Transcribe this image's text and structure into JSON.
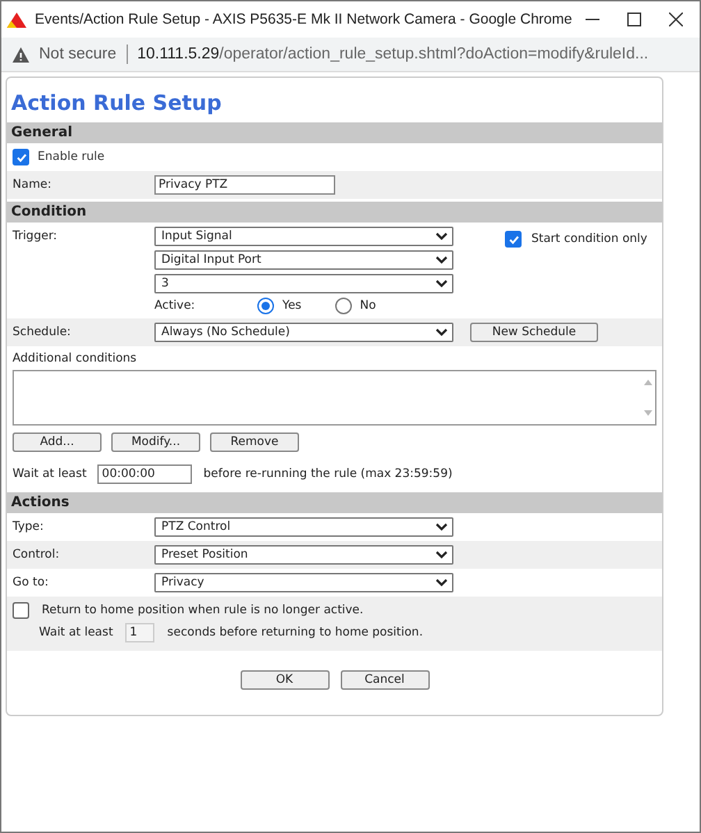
{
  "window": {
    "title": "Events/Action Rule Setup - AXIS P5635-E Mk II Network Camera - Google Chrome"
  },
  "address_bar": {
    "security": "Not secure",
    "url_host": "10.111.5.29",
    "url_path": "/operator/action_rule_setup.shtml?doAction=modify&ruleId..."
  },
  "page_title": "Action Rule Setup",
  "general": {
    "heading": "General",
    "enable_rule": {
      "label": "Enable rule",
      "checked": true
    },
    "name": {
      "label": "Name:",
      "value": "Privacy PTZ"
    }
  },
  "condition": {
    "heading": "Condition",
    "trigger": {
      "label": "Trigger:",
      "selects": [
        "Input Signal",
        "Digital Input Port",
        "3"
      ]
    },
    "start_condition_only": {
      "label": "Start condition only",
      "checked": true
    },
    "active": {
      "label": "Active:",
      "options": [
        {
          "label": "Yes",
          "selected": true
        },
        {
          "label": "No",
          "selected": false
        }
      ]
    },
    "schedule": {
      "label": "Schedule:",
      "value": "Always (No Schedule)",
      "button": "New Schedule"
    },
    "additional_conditions": {
      "label": "Additional conditions",
      "buttons": [
        "Add...",
        "Modify...",
        "Remove"
      ]
    },
    "wait": {
      "label": "Wait at least",
      "value": "00:00:00",
      "note": "before re-running the rule (max 23:59:59)"
    }
  },
  "actions": {
    "heading": "Actions",
    "fields": [
      {
        "label": "Type:",
        "value": "PTZ Control"
      },
      {
        "label": "Control:",
        "value": "Preset Position"
      },
      {
        "label": "Go to:",
        "value": "Privacy"
      }
    ],
    "return_home": {
      "label": "Return to home position when rule is no longer active.",
      "checked": false
    },
    "wait": {
      "label": "Wait at least",
      "value": "1",
      "note": "seconds before returning to home position."
    }
  },
  "buttons": [
    "OK",
    "Cancel"
  ]
}
